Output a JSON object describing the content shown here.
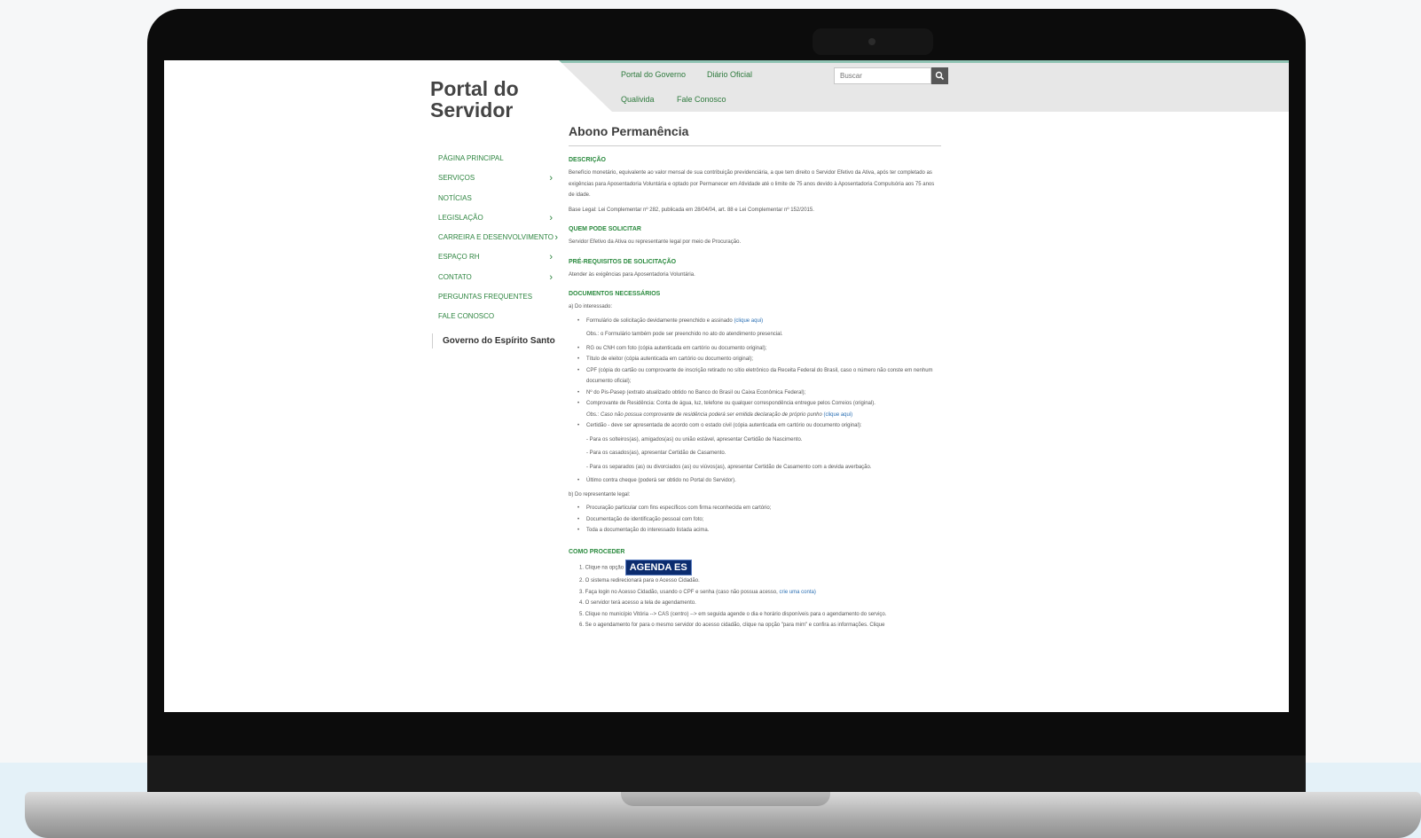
{
  "site": {
    "brand": "Portal do Servidor"
  },
  "topnav": {
    "links": [
      "Portal do Governo",
      "Diário Oficial",
      "Qualivida",
      "Fale Conosco"
    ],
    "search_placeholder": "Buscar"
  },
  "sidebar": {
    "items": [
      {
        "label": "PÁGINA PRINCIPAL",
        "chevron": false
      },
      {
        "label": "SERVIÇOS",
        "chevron": true
      },
      {
        "label": "NOTÍCIAS",
        "chevron": false
      },
      {
        "label": "LEGISLAÇÃO",
        "chevron": true
      },
      {
        "label": "CARREIRA E DESENVOLVIMENTO",
        "chevron": true
      },
      {
        "label": "ESPAÇO RH",
        "chevron": true
      },
      {
        "label": "CONTATO",
        "chevron": true
      },
      {
        "label": "PERGUNTAS FREQUENTES",
        "chevron": false
      },
      {
        "label": "FALE CONOSCO",
        "chevron": false
      }
    ],
    "gov_link": "Governo do Espírito Santo"
  },
  "page": {
    "title": "Abono Permanência",
    "descricao": {
      "heading": "DESCRIÇÃO",
      "p1": "Benefício monetário, equivalente ao valor mensal de sua contribuição previdenciária, a que tem direito o Servidor Efetivo da Ativa, após ter completado as exigências para Aposentadoria Voluntária e optado por Permanecer em Atividade até o limite de 75 anos devido à Aposentadoria Compulsória aos 75 anos de idade.",
      "p2": "Base Legal: Lei Complementar nº 282, publicada em 28/04/04, art. 88 e Lei Complementar nº 152/2015."
    },
    "quem": {
      "heading": "QUEM PODE SOLICITAR",
      "p": "Servidor Efetivo da Ativa ou representante legal por meio de Procuração."
    },
    "pre": {
      "heading": "PRÉ-REQUISITOS DE SOLICITAÇÃO",
      "p": "Atender às exigências para Aposentadoria Voluntária."
    },
    "docs": {
      "heading": "DOCUMENTOS NECESSÁRIOS",
      "a_label": "a) Do interessado:",
      "form_text": "Formulário de solicitação devidamente preenchido e assinado",
      "form_link": "(clique aqui)",
      "form_obs": "Obs.: o Formulário também pode ser preenchido no ato do atendimento presencial.",
      "rg": "RG ou CNH com foto (cópia autenticada em cartório ou documento original);",
      "titulo": "Título de eleitor (cópia autenticada em cartório ou documento original);",
      "cpf": "CPF (cópia do cartão ou comprovante de inscrição retirado no sítio eletrônico da Receita Federal do Brasil, caso o número não conste em nenhum documento oficial);",
      "pis": "Nº do Pis-Pasep (extrato atualizado obtido no Banco do Brasil ou Caixa Econômica Federal);",
      "residencia": "Comprovante de Residência: Conta de água, luz, telefone ou qualquer correspondência entregue pelos Correios (original).",
      "residencia_obs": "Obs.: Caso não possua comprovante de residência poderá ser emitida declaração de próprio punho",
      "residencia_link": "(clique aqui)",
      "certidao": "Certidão - deve ser apresentada de acordo com o estado civil (cópia autenticada em cartório ou documento original):",
      "solteiros": "- Para os solteiros(as), amigados(as) ou união estável, apresentar Certidão de Nascimento.",
      "casados": "- Para os casados(as), apresentar Certidão de Casamento.",
      "separados": "- Para os separados (as) ou divorciados (as) ou viúvos(as), apresentar Certidão de Casamento com a devida averbação.",
      "contracheque": "Último contra cheque (poderá ser obtido no Portal do Servidor).",
      "b_label": "b) Do representante legal:",
      "procuracao": "Procuração particular com fins específicos com firma reconhecida em cartório;",
      "identificacao": "Documentação de identificação pessoal com foto;",
      "toda": "Toda a documentação do interessado listada acima."
    },
    "como": {
      "heading": "COMO PROCEDER",
      "s1": "1. Clique na opção",
      "agenda_label": "AGENDA ES",
      "s2": "2. O sistema redirecionará para o Acesso Cidadão.",
      "s3": "3. Faça login no Acesso Cidadão, usando o CPF e senha (caso não possua acesso,",
      "s3_link": "crie uma conta)",
      "s4": "4. O servidor terá acesso a tela de agendamento.",
      "s5": "5. Clique no município Vitória --> CAS (centro) --> em seguida agende o dia e horário disponíveis para o agendamento do serviço.",
      "s6": "6. Se o agendamento for para o mesmo servidor do acesso cidadão, clique na opção \"para mim\" e confira as informações. Clique"
    }
  }
}
